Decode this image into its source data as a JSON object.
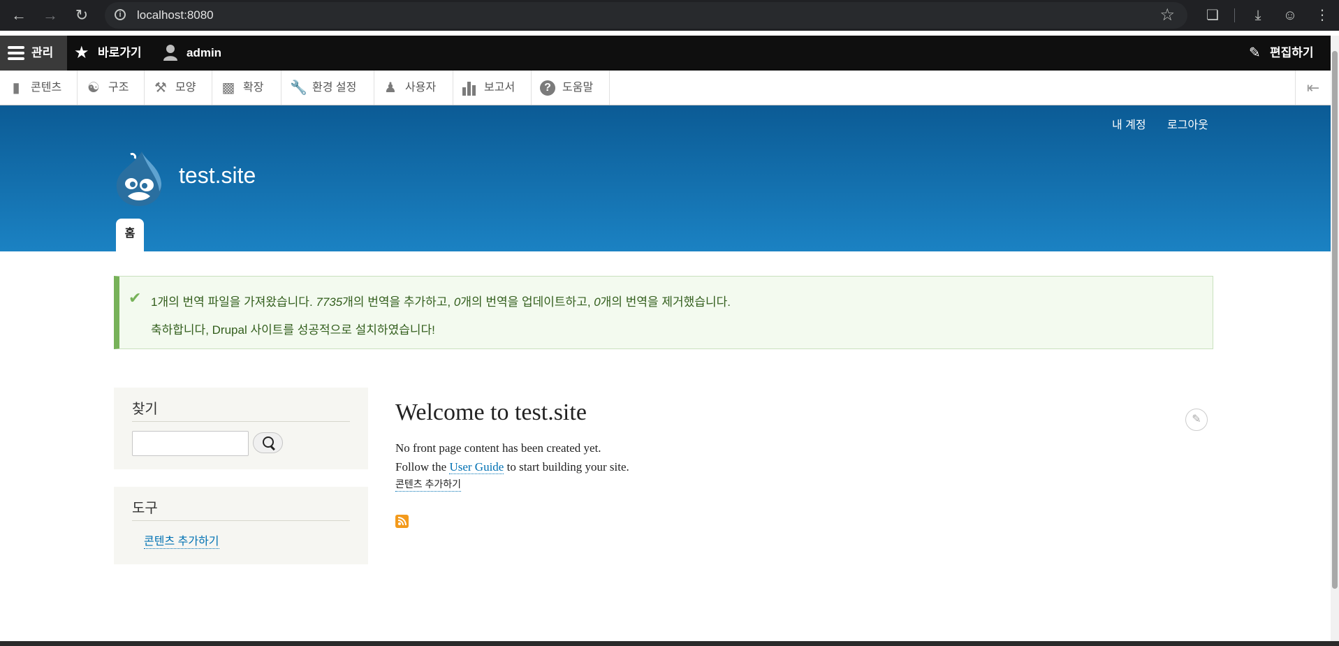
{
  "browser": {
    "url": "localhost:8080"
  },
  "toolbar": {
    "manage": "관리",
    "shortcuts": "바로가기",
    "user": "admin",
    "edit": "편집하기"
  },
  "tray": [
    {
      "label": "콘텐츠",
      "icon": "file-icon"
    },
    {
      "label": "구조",
      "icon": "structure-icon"
    },
    {
      "label": "모양",
      "icon": "paintbrush-icon"
    },
    {
      "label": "확장",
      "icon": "puzzle-icon"
    },
    {
      "label": "환경 설정",
      "icon": "wrench-icon"
    },
    {
      "label": "사용자",
      "icon": "people-icon"
    },
    {
      "label": "보고서",
      "icon": "bar-chart-icon"
    },
    {
      "label": "도움말",
      "icon": "question-icon"
    }
  ],
  "header": {
    "account": "내 계정",
    "logout": "로그아웃",
    "site_name": "test.site",
    "home_tab": "홈"
  },
  "message": {
    "l1_a": "1개의 번역 파일을 가져왔습니다. ",
    "l1_n1": "7735",
    "l1_b": "개의 번역을 추가하고, ",
    "l1_n2": "0",
    "l1_c": "개의 번역을 업데이트하고, ",
    "l1_n3": "0",
    "l1_d": "개의 번역을 제거했습니다.",
    "l2": "축하합니다, Drupal 사이트를 성공적으로 설치하였습니다!"
  },
  "search_block": {
    "title": "찾기",
    "value": ""
  },
  "tools_block": {
    "title": "도구",
    "link": "콘텐츠 추가하기"
  },
  "main": {
    "title": "Welcome to test.site",
    "p1": "No front page content has been created yet.",
    "p2_a": "Follow the ",
    "p2_link": "User Guide",
    "p2_b": " to start building your site.",
    "add_link": "콘텐츠 추가하기"
  },
  "colors": {
    "header_top": "#0b5b95",
    "header_bottom": "#1b82c3",
    "status_border": "#77b259",
    "link": "#0071b3",
    "rss": "#f39a1c"
  }
}
